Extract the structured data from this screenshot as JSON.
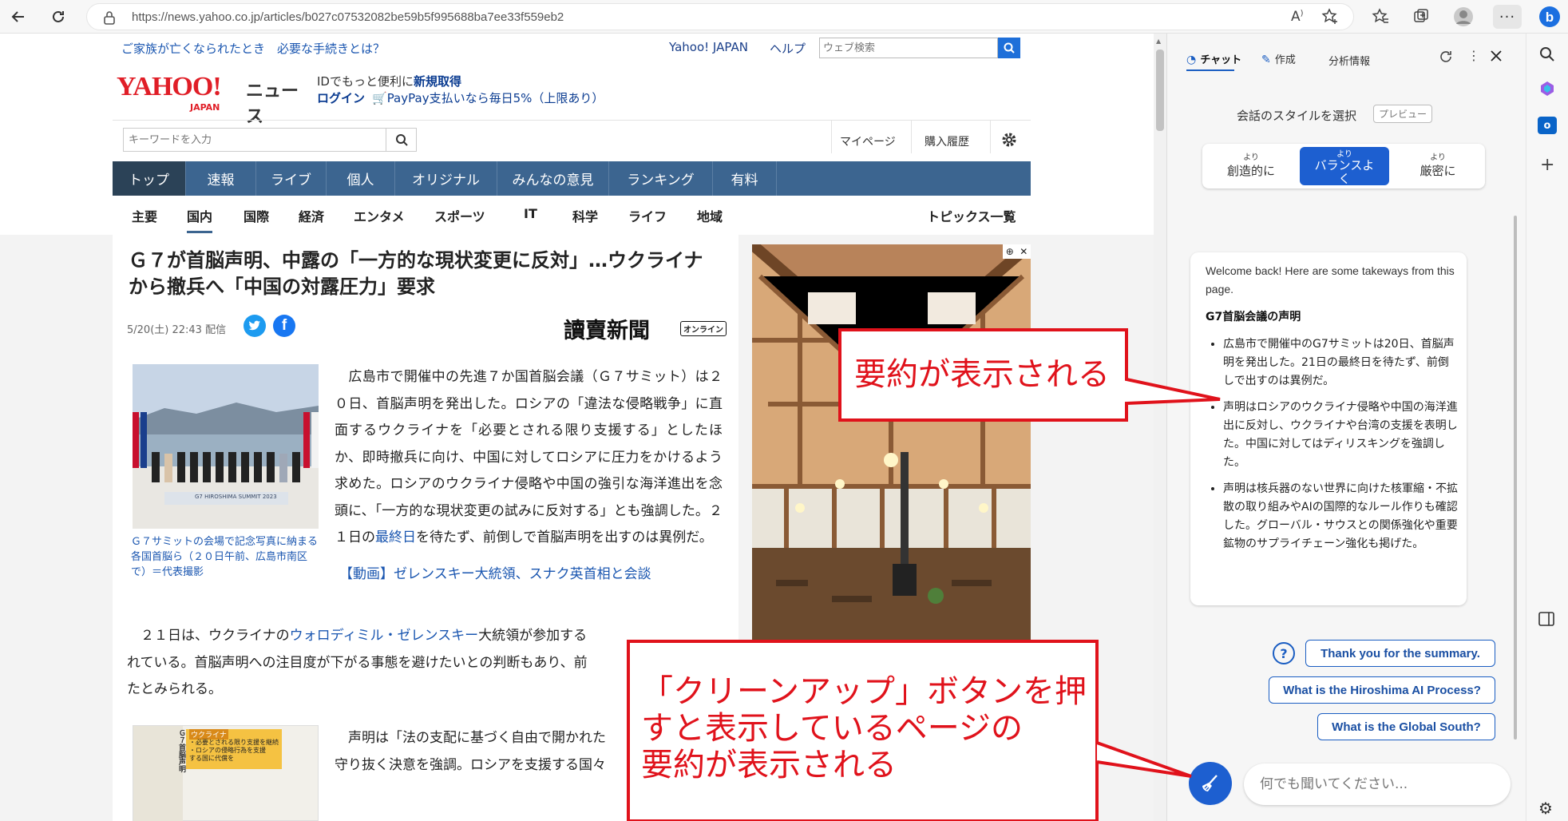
{
  "browser": {
    "url": "https://news.yahoo.co.jp/articles/b027c07532082be59b5f995688ba7ee33f559eb2",
    "icons": [
      "back-icon",
      "refresh-icon",
      "lock-icon",
      "read-aloud-icon",
      "favorite-add-icon",
      "favorites-icon",
      "collections-icon",
      "profile-icon",
      "more-icon",
      "bing-icon"
    ]
  },
  "yahoo": {
    "promo_link": "ご家族が亡くなられたとき　必要な手続きとは？",
    "top_links": {
      "japan": "Yahoo! JAPAN",
      "help": "ヘルプ"
    },
    "web_search_placeholder": "ウェブ検索",
    "logo_main": "YAHOO!",
    "logo_sub": "JAPAN",
    "logo_news": "ニュース",
    "id_text": "IDでもっと便利に",
    "id_link": "新規取得",
    "login": "ログイン",
    "paypay": "PayPay支払いなら毎日5%（上限あり）",
    "keyword_placeholder": "キーワードを入力",
    "mypage": "マイページ",
    "history": "購入履歴",
    "main_nav": [
      "トップ",
      "速報",
      "ライブ",
      "個人",
      "オリジナル",
      "みんなの意見",
      "ランキング",
      "有料"
    ],
    "sub_nav": [
      "主要",
      "国内",
      "国際",
      "経済",
      "エンタメ",
      "スポーツ",
      "IT",
      "科学",
      "ライフ",
      "地域"
    ],
    "topics": "トピックス一覧"
  },
  "article": {
    "title_line1": "Ｇ７が首脳声明、中露の「一方的な現状変更に反対」…ウクライナ",
    "title_line2": "から撤兵へ「中国の対露圧力」要求",
    "date": "5/20(土) 22:43 配信",
    "publisher": "讀賣新聞",
    "publisher_tag": "オンライン",
    "photo_caption_image": "G7 HIROSHIMA SUMMIT 2023",
    "photo_caption": "Ｇ７サミットの会場で記念写真に納まる各国首脳ら（２０日午前、広島市南区で）＝代表撮影",
    "para1": "　広島市で開催中の先進７か国首脳会議（Ｇ７サミット）は２０日、首脳声明を発出した。ロシアの「違法な侵略戦争」に直面するウクライナを「必要とされる限り支援する」としたほか、即時撤兵に向け、中国に対してロシアに圧力をかけるよう求めた。ロシアのウクライナ侵略や中国の強引な海洋進出を念頭に、「一方的な現状変更の試みに反対する」とも強調した。２１日の",
    "para1_link": "最終日",
    "para1_end": "を待たず、前倒しで首脳声明を出すのは異例だ。",
    "video_link": "【動画】ゼレンスキー大統領、スナク英首相と会談",
    "para2_a": "　２１日は、ウクライナの",
    "para2_link": "ウォロディミル・ゼレンスキー",
    "para2_b": "大統領が参加する",
    "para2_line2": "れている。首脳声明への注目度が下がる事態を避けたいとの判断もあり、前",
    "para2_line3": "たとみられる。",
    "para3_line1": "　声明は「法の支配に基づく自由で開かれた",
    "para3_line2": "守り抜く決意を強調。ロシアを支援する国々",
    "thumb_tag": "ウクライナ",
    "thumb_lines": [
      "・必要とされる限り支援を継続",
      "・ロシアの侵略行為を支援",
      "する国に代償を"
    ],
    "thumb_side": "Ｇ７首脳声明"
  },
  "copilot": {
    "tabs": [
      "チャット",
      "作成",
      "分析情報"
    ],
    "style_label": "会話のスタイルを選択",
    "preview_badge": "プレビュー",
    "styles": [
      {
        "small": "より",
        "label": "創造的に"
      },
      {
        "small": "より",
        "label": "バランスよく"
      },
      {
        "small": "より",
        "label": "厳密に"
      }
    ],
    "welcome": "Welcome back! Here are some takeways from this page.",
    "summary_title": "G7首脳会議の声明",
    "bullets": [
      "広島市で開催中のG7サミットは20日、首脳声明を発出した。21日の最終日を待たず、前倒しで出すのは異例だ。",
      "声明はロシアのウクライナ侵略や中国の海洋進出に反対し、ウクライナや台湾の支援を表明した。中国に対してはディリスキングを強調した。",
      "声明は核兵器のない世界に向けた核軍縮・不拡散の取り組みやAIの国際的なルール作りも確認した。グローバル・サウスとの関係強化や重要鉱物のサプライチェーン強化も掲げた。"
    ],
    "suggestions": [
      "Thank you for the summary.",
      "What is the Hiroshima AI Process?",
      "What is the Global South?"
    ],
    "input_placeholder": "何でも聞いてください..."
  },
  "callouts": {
    "summary": "要約が表示される",
    "cleanup_lines": [
      "「クリーンアップ」ボタンを押",
      "すと表示しているページの",
      "要約が表示される"
    ]
  },
  "colors": {
    "nav": "#3c6590",
    "nav_active": "#2b4257",
    "accent": "#1a5dc2",
    "callout": "#e0121b",
    "link": "#1a56b0"
  }
}
